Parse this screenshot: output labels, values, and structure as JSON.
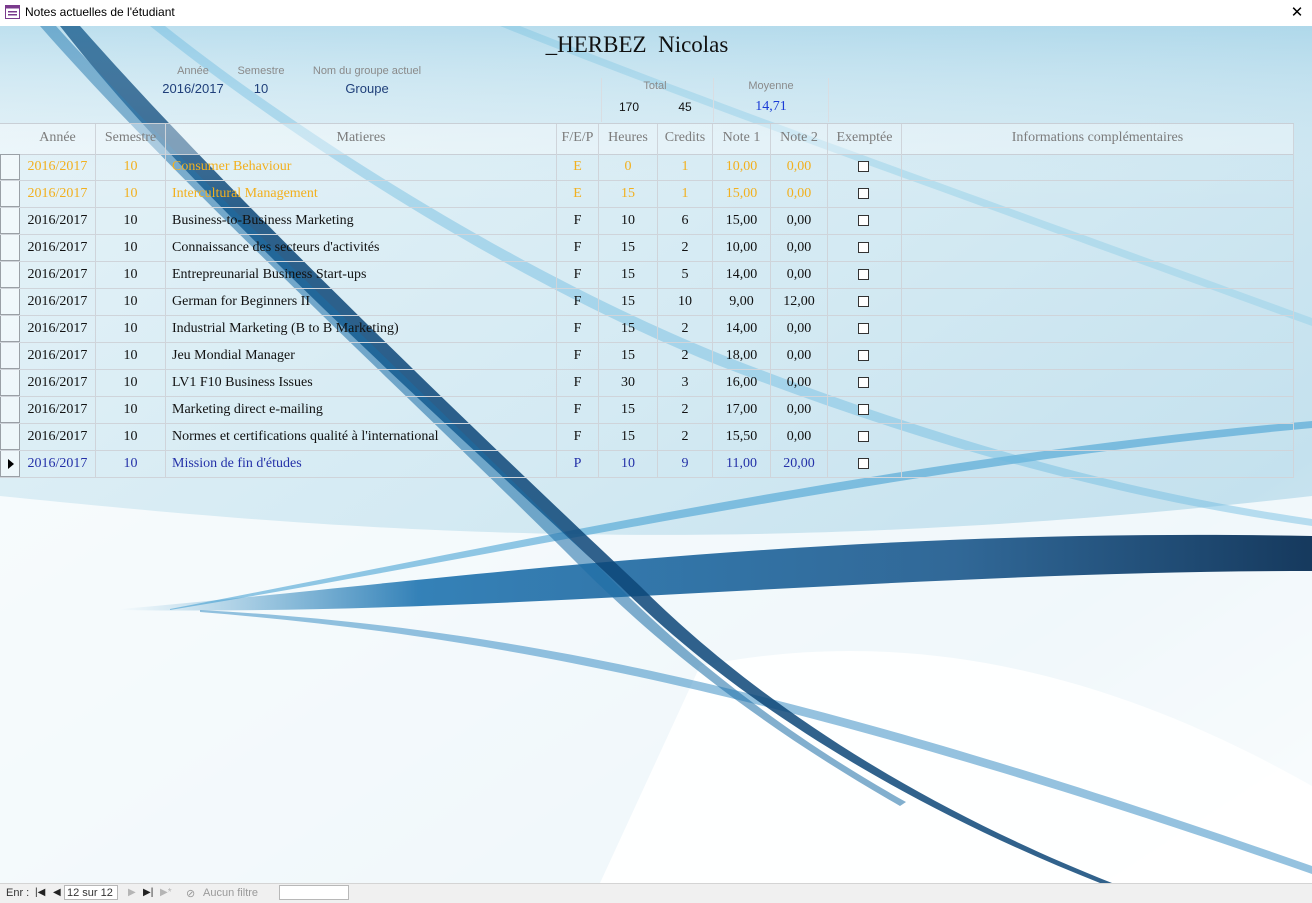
{
  "window": {
    "title": "Notes actuelles de l'étudiant"
  },
  "student": {
    "name": "_HERBEZ  Nicolas"
  },
  "summary": {
    "annee_label": "Année",
    "annee_value": "2016/2017",
    "semestre_label": "Semestre",
    "semestre_value": "10",
    "groupe_label": "Nom du groupe actuel",
    "groupe_value": "Groupe",
    "total_label": "Total",
    "total_heures": "170",
    "total_credits": "45",
    "moyenne_label": "Moyenne",
    "moyenne_value": "14,71"
  },
  "colors": {
    "optional": "#f2b01e",
    "project": "#2431a8",
    "normal": "#111111",
    "header": "#7c7c7c"
  },
  "columns": [
    "Année",
    "Semestre",
    "Matieres",
    "F/E/P",
    "Heures",
    "Credits",
    "Note 1",
    "Note 2",
    "Exemptée",
    "Informations complémentaires"
  ],
  "rows": [
    {
      "annee": "2016/2017",
      "semestre": "10",
      "matiere": "Consumer Behaviour",
      "type": "E",
      "heures": "0",
      "credits": "1",
      "note1": "10,00",
      "note2": "0,00",
      "exemptee": false,
      "info": ""
    },
    {
      "annee": "2016/2017",
      "semestre": "10",
      "matiere": "Intercultural Management",
      "type": "E",
      "heures": "15",
      "credits": "1",
      "note1": "15,00",
      "note2": "0,00",
      "exemptee": false,
      "info": ""
    },
    {
      "annee": "2016/2017",
      "semestre": "10",
      "matiere": "Business-to-Business Marketing",
      "type": "F",
      "heures": "10",
      "credits": "6",
      "note1": "15,00",
      "note2": "0,00",
      "exemptee": false,
      "info": ""
    },
    {
      "annee": "2016/2017",
      "semestre": "10",
      "matiere": "Connaissance des secteurs d'activités",
      "type": "F",
      "heures": "15",
      "credits": "2",
      "note1": "10,00",
      "note2": "0,00",
      "exemptee": false,
      "info": ""
    },
    {
      "annee": "2016/2017",
      "semestre": "10",
      "matiere": "Entrepreunarial Business Start-ups",
      "type": "F",
      "heures": "15",
      "credits": "5",
      "note1": "14,00",
      "note2": "0,00",
      "exemptee": false,
      "info": ""
    },
    {
      "annee": "2016/2017",
      "semestre": "10",
      "matiere": "German for Beginners II",
      "type": "F",
      "heures": "15",
      "credits": "10",
      "note1": "9,00",
      "note2": "12,00",
      "exemptee": false,
      "info": ""
    },
    {
      "annee": "2016/2017",
      "semestre": "10",
      "matiere": "Industrial Marketing (B to B Marketing)",
      "type": "F",
      "heures": "15",
      "credits": "2",
      "note1": "14,00",
      "note2": "0,00",
      "exemptee": false,
      "info": ""
    },
    {
      "annee": "2016/2017",
      "semestre": "10",
      "matiere": "Jeu Mondial Manager",
      "type": "F",
      "heures": "15",
      "credits": "2",
      "note1": "18,00",
      "note2": "0,00",
      "exemptee": false,
      "info": ""
    },
    {
      "annee": "2016/2017",
      "semestre": "10",
      "matiere": "LV1 F10 Business Issues",
      "type": "F",
      "heures": "30",
      "credits": "3",
      "note1": "16,00",
      "note2": "0,00",
      "exemptee": false,
      "info": ""
    },
    {
      "annee": "2016/2017",
      "semestre": "10",
      "matiere": "Marketing direct e-mailing",
      "type": "F",
      "heures": "15",
      "credits": "2",
      "note1": "17,00",
      "note2": "0,00",
      "exemptee": false,
      "info": ""
    },
    {
      "annee": "2016/2017",
      "semestre": "10",
      "matiere": "Normes et certifications qualité à l'international",
      "type": "F",
      "heures": "15",
      "credits": "2",
      "note1": "15,50",
      "note2": "0,00",
      "exemptee": false,
      "info": ""
    },
    {
      "annee": "2016/2017",
      "semestre": "10",
      "matiere": "Mission de fin d'études",
      "type": "P",
      "heures": "10",
      "credits": "9",
      "note1": "11,00",
      "note2": "20,00",
      "exemptee": false,
      "info": ""
    }
  ],
  "statusbar": {
    "enr_label": "Enr :",
    "position": "12 sur 12",
    "filter_label": "Aucun filtre",
    "search_value": ""
  },
  "icons": {
    "first": "first-record-icon",
    "prev": "prev-record-icon",
    "next": "next-record-icon",
    "last": "last-record-icon",
    "new": "new-record-icon",
    "filter": "no-filter-icon",
    "close": "close-icon",
    "app": "form-icon"
  }
}
